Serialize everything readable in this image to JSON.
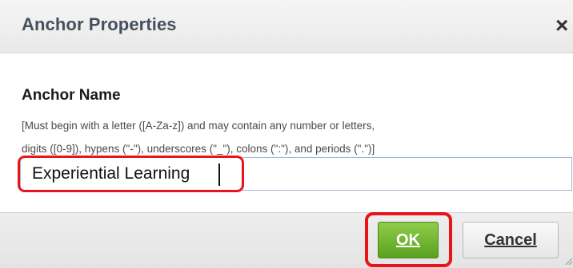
{
  "dialog": {
    "title": "Anchor Properties",
    "close_glyph": "×",
    "close_icon": "close-icon"
  },
  "form": {
    "label": "Anchor Name",
    "hint_line1": "[Must begin with a letter ([A-Za-z]) and may contain any number or letters,",
    "hint_line2": "digits ([0-9]), hypens (\"-\"), underscores (\"_\"), colons (\":\"), and periods (\".\")]",
    "value": "Experiential Learning"
  },
  "buttons": {
    "ok_label": "OK",
    "cancel_label": "Cancel"
  },
  "colors": {
    "highlight": "#e8141a",
    "ok_green": "#6cb52a",
    "title_text": "#46505c"
  }
}
